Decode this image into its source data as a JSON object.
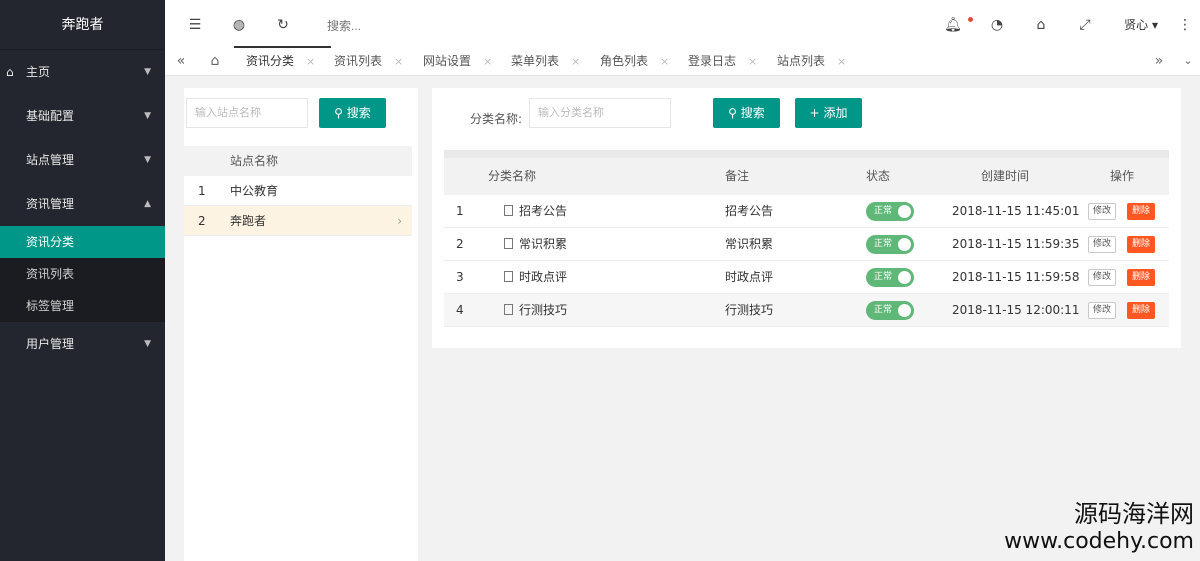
{
  "sidebar": {
    "brand": "奔跑者",
    "items": [
      {
        "label": "主页"
      },
      {
        "label": "基础配置"
      },
      {
        "label": "站点管理"
      },
      {
        "label": "资讯管理"
      },
      {
        "label": "用户管理"
      }
    ],
    "sub": [
      {
        "label": "资讯分类"
      },
      {
        "label": "资讯列表"
      },
      {
        "label": "标签管理"
      }
    ]
  },
  "header": {
    "search_placeholder": "搜索...",
    "user": "贤心 ▾"
  },
  "tabs": [
    "资讯分类",
    "资讯列表",
    "网站设置",
    "菜单列表",
    "角色列表",
    "登录日志",
    "站点列表"
  ],
  "left": {
    "input_placeholder": "输入站点名称",
    "search_label": "搜索",
    "col_name": "站点名称",
    "rows": [
      {
        "idx": "1",
        "name": "中公教育"
      },
      {
        "idx": "2",
        "name": "奔跑者"
      }
    ]
  },
  "right": {
    "label": "分类名称:",
    "input_placeholder": "输入分类名称",
    "search_label": "搜索",
    "add_label": "添加",
    "columns": {
      "name": "分类名称",
      "note": "备注",
      "status": "状态",
      "created": "创建时间",
      "ops": "操作"
    },
    "rows": [
      {
        "idx": "1",
        "name": "招考公告",
        "note": "招考公告",
        "status": "正常",
        "created": "2018-11-15 11:45:01",
        "edit": "修改",
        "del": "删除"
      },
      {
        "idx": "2",
        "name": "常识积累",
        "note": "常识积累",
        "status": "正常",
        "created": "2018-11-15 11:59:35",
        "edit": "修改",
        "del": "删除"
      },
      {
        "idx": "3",
        "name": "时政点评",
        "note": "时政点评",
        "status": "正常",
        "created": "2018-11-15 11:59:58",
        "edit": "修改",
        "del": "删除"
      },
      {
        "idx": "4",
        "name": "行测技巧",
        "note": "行测技巧",
        "status": "正常",
        "created": "2018-11-15 12:00:11",
        "edit": "修改",
        "del": "删除"
      }
    ]
  },
  "watermark": {
    "line1": "源码海洋网",
    "line2": "www.codehy.com"
  },
  "colors": {
    "accent": "#009688",
    "sidebar": "#23262e",
    "switch_on": "#5fb878",
    "danger": "#ff5722"
  }
}
